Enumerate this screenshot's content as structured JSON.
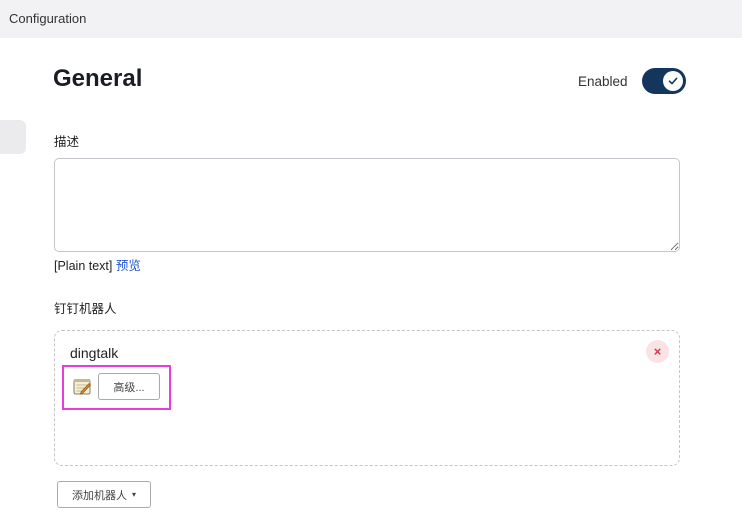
{
  "header": {
    "breadcrumb": "Configuration"
  },
  "section": {
    "title": "General",
    "enabled_label": "Enabled",
    "enabled": true
  },
  "description": {
    "label": "描述",
    "value": "",
    "markup_format": "[Plain text]",
    "preview_link": "预览"
  },
  "robots": {
    "label": "钉钉机器人",
    "items": [
      {
        "name": "dingtalk",
        "advanced_button": "高级...",
        "delete_symbol": "×"
      }
    ],
    "add_button": "添加机器人",
    "add_caret": "▾"
  },
  "colors": {
    "toggle_bg": "#14365c",
    "highlight_border": "#e83cdc",
    "link": "#2356c9",
    "delete_bg": "#fbe3e5",
    "delete_fg": "#d33a48"
  },
  "icons": {
    "toggle_check": "check-icon",
    "item_icon": "notepad-icon",
    "delete": "close-icon"
  }
}
